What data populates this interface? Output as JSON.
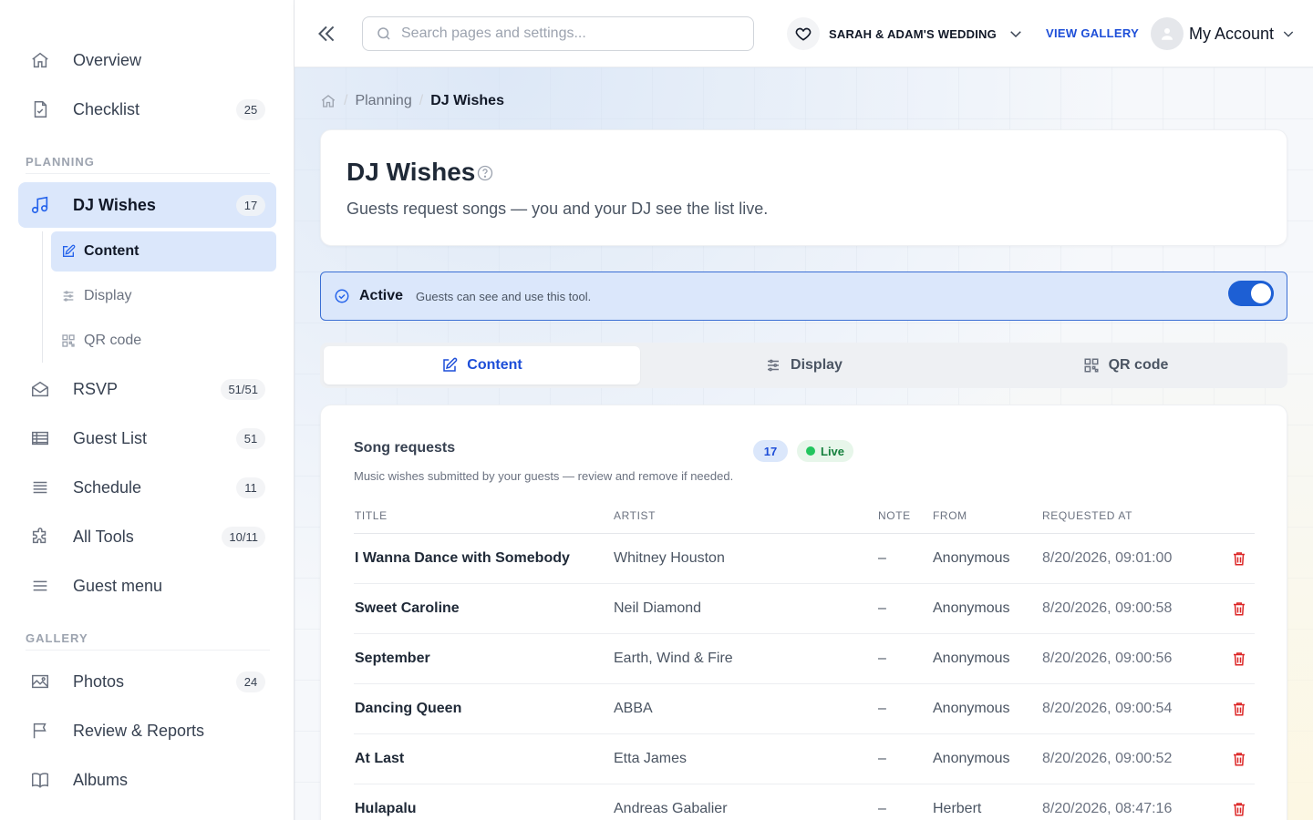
{
  "sidebar": {
    "items": [
      {
        "label": "Overview",
        "badge": "",
        "icon": "home-icon"
      },
      {
        "label": "Checklist",
        "badge": "25",
        "icon": "checklist-icon"
      }
    ],
    "section_planning": "PLANNING",
    "planning_items": [
      {
        "label": "DJ Wishes",
        "badge": "17",
        "icon": "music-icon"
      },
      {
        "label": "RSVP",
        "badge": "51/51",
        "icon": "envelope-icon"
      },
      {
        "label": "Guest List",
        "badge": "51",
        "icon": "table-icon"
      },
      {
        "label": "Schedule",
        "badge": "11",
        "icon": "list-icon"
      },
      {
        "label": "All Tools",
        "badge": "10/11",
        "icon": "puzzle-icon"
      },
      {
        "label": "Guest menu",
        "badge": "",
        "icon": "menu-icon"
      }
    ],
    "sub_items": [
      {
        "label": "Content",
        "icon": "edit-icon"
      },
      {
        "label": "Display",
        "icon": "sliders-icon"
      },
      {
        "label": "QR code",
        "icon": "qr-icon"
      }
    ],
    "section_gallery": "GALLERY",
    "gallery_items": [
      {
        "label": "Photos",
        "badge": "24",
        "icon": "image-icon"
      },
      {
        "label": "Review & Reports",
        "badge": "",
        "icon": "flag-icon"
      },
      {
        "label": "Albums",
        "badge": "",
        "icon": "book-icon"
      }
    ]
  },
  "topbar": {
    "search_placeholder": "Search pages and settings...",
    "event_name": "SARAH & ADAM'S WEDDING",
    "view_gallery": "VIEW GALLERY",
    "account_label": "My Account"
  },
  "breadcrumb": {
    "parent": "Planning",
    "current": "DJ Wishes"
  },
  "header": {
    "title": "DJ Wishes",
    "subtitle": "Guests request songs — you and your DJ see the list live."
  },
  "active_bar": {
    "title": "Active",
    "description": "Guests can see and use this tool.",
    "enabled": true
  },
  "tabs": [
    {
      "label": "Content",
      "icon": "edit-icon"
    },
    {
      "label": "Display",
      "icon": "sliders-icon"
    },
    {
      "label": "QR code",
      "icon": "qr-icon"
    }
  ],
  "requests": {
    "title": "Song requests",
    "count": "17",
    "live_label": "Live",
    "description": "Music wishes submitted by your guests — review and remove if needed.",
    "columns": [
      "TITLE",
      "ARTIST",
      "NOTE",
      "FROM",
      "REQUESTED AT"
    ],
    "rows": [
      {
        "title": "I Wanna Dance with Somebody",
        "artist": "Whitney Houston",
        "note": "–",
        "from": "Anonymous",
        "date": "8/20/2026, 09:01:00"
      },
      {
        "title": "Sweet Caroline",
        "artist": "Neil Diamond",
        "note": "–",
        "from": "Anonymous",
        "date": "8/20/2026, 09:00:58"
      },
      {
        "title": "September",
        "artist": "Earth, Wind & Fire",
        "note": "–",
        "from": "Anonymous",
        "date": "8/20/2026, 09:00:56"
      },
      {
        "title": "Dancing Queen",
        "artist": "ABBA",
        "note": "–",
        "from": "Anonymous",
        "date": "8/20/2026, 09:00:54"
      },
      {
        "title": "At Last",
        "artist": "Etta James",
        "note": "–",
        "from": "Anonymous",
        "date": "8/20/2026, 09:00:52"
      },
      {
        "title": "Hulapalu",
        "artist": "Andreas Gabalier",
        "note": "–",
        "from": "Herbert",
        "date": "8/20/2026, 08:47:16"
      }
    ]
  },
  "colors": {
    "accent": "#1d4ed8",
    "active_bg": "#dbe7fb",
    "live_green": "#22c55e",
    "delete_red": "#dc2626"
  }
}
